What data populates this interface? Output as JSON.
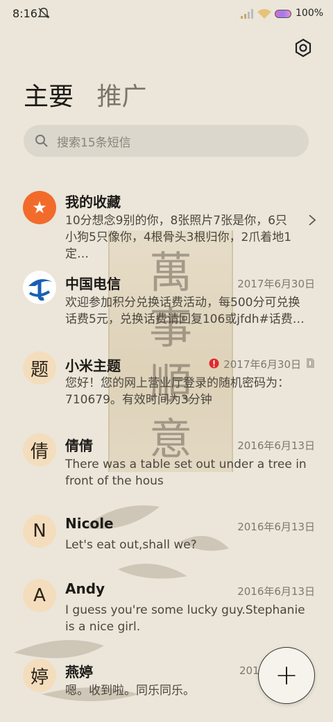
{
  "status_bar": {
    "time": "8:16",
    "battery": "100%"
  },
  "tabs": [
    "主要",
    "推广"
  ],
  "search": {
    "placeholder": "搜索15条短信"
  },
  "wallpaper_text": [
    "萬",
    "事",
    "順",
    "意"
  ],
  "conversations": [
    {
      "avatar": "★",
      "name": "我的收藏",
      "date": "",
      "preview": "10分想念9别的你，8张照片7张是你，6只小狗5只像你，4根骨头3根归你，2爪着地1定…",
      "has_chevron": true
    },
    {
      "avatar": "telecom-logo",
      "name": "中国电信",
      "date": "2017年6月30日",
      "preview": "欢迎参加积分兑换话费活动，每500分可兑换话费5元，兑换话费请回复106或jfdh#话费…"
    },
    {
      "avatar": "题",
      "name": "小米主题",
      "date": "2017年6月30日",
      "preview": "您好！您的网上营业厅登录的随机密码为：710679。有效时间为3分钟",
      "has_error": true,
      "has_sim": true
    },
    {
      "avatar": "倩",
      "name": "倩倩",
      "date": "2016年6月13日",
      "preview": "There was a table set out under a tree in front of the hous"
    },
    {
      "avatar": "N",
      "name": "Nicole",
      "date": "2016年6月13日",
      "preview": "Let's eat out,shall we?"
    },
    {
      "avatar": "A",
      "name": "Andy",
      "date": "2016年6月13日",
      "preview": "I guess you're some lucky guy.Stephanie is a nice girl."
    },
    {
      "avatar": "婷",
      "name": "燕婷",
      "date": "201",
      "preview": "嗯。收到啦。同乐同乐。"
    }
  ],
  "fab": {
    "label": "+"
  },
  "colors": {
    "background": "#ebe6d9",
    "avatar_bg": "#f4ddbd",
    "favorite": "#f36b2b",
    "error": "#e02b2b"
  }
}
